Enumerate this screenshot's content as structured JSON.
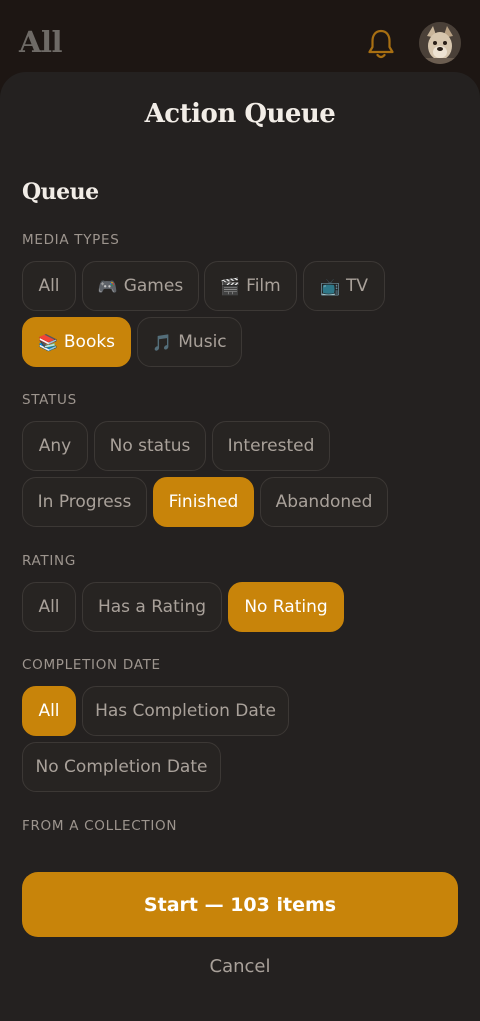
{
  "topbar": {
    "title": "All"
  },
  "sheet": {
    "title": "Action Queue",
    "section_title": "Queue"
  },
  "media_types": {
    "label": "MEDIA TYPES",
    "options": [
      {
        "icon": "",
        "label": "All",
        "selected": false
      },
      {
        "icon": "🎮",
        "label": "Games",
        "selected": false
      },
      {
        "icon": "🎬",
        "label": "Film",
        "selected": false
      },
      {
        "icon": "📺",
        "label": "TV",
        "selected": false
      },
      {
        "icon": "📚",
        "label": "Books",
        "selected": true
      },
      {
        "icon": "🎵",
        "label": "Music",
        "selected": false
      }
    ]
  },
  "status": {
    "label": "STATUS",
    "options": [
      {
        "label": "Any",
        "selected": false
      },
      {
        "label": "No status",
        "selected": false
      },
      {
        "label": "Interested",
        "selected": false
      },
      {
        "label": "In Progress",
        "selected": false
      },
      {
        "label": "Finished",
        "selected": true
      },
      {
        "label": "Abandoned",
        "selected": false
      }
    ]
  },
  "rating": {
    "label": "RATING",
    "options": [
      {
        "label": "All",
        "selected": false
      },
      {
        "label": "Has a Rating",
        "selected": false
      },
      {
        "label": "No Rating",
        "selected": true
      }
    ]
  },
  "completion_date": {
    "label": "COMPLETION DATE",
    "options": [
      {
        "label": "All",
        "selected": true
      },
      {
        "label": "Has Completion Date",
        "selected": false
      },
      {
        "label": "No Completion Date",
        "selected": false
      }
    ]
  },
  "collection": {
    "label": "FROM A COLLECTION"
  },
  "actions": {
    "start_label": "Start — 103 items",
    "cancel_label": "Cancel"
  },
  "colors": {
    "accent": "#c8840a",
    "background": "#242120",
    "chip_border": "#3c3835"
  }
}
